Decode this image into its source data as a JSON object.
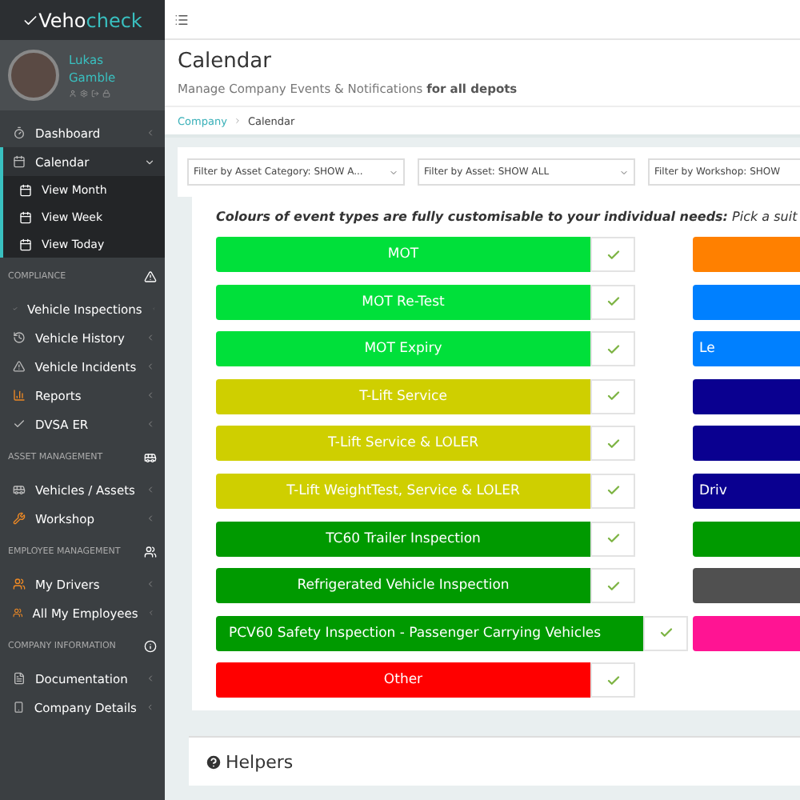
{
  "brand": {
    "first": "Veho",
    "second": "check"
  },
  "user": {
    "name": "Lukas Gamble"
  },
  "sidebar": {
    "sections": [
      {
        "items": [
          {
            "label": "Dashboard",
            "selected": false,
            "expanded": false
          },
          {
            "label": "Calendar",
            "selected": true,
            "expanded": true,
            "children": [
              {
                "label": "View Month"
              },
              {
                "label": "View Week"
              },
              {
                "label": "View Today"
              }
            ]
          }
        ]
      },
      {
        "title": "COMPLIANCE",
        "items": [
          {
            "label": "Vehicle Inspections",
            "selected": false,
            "expanded": false
          },
          {
            "label": "Vehicle History",
            "selected": false,
            "expanded": false
          },
          {
            "label": "Vehicle Incidents",
            "selected": false,
            "expanded": false
          },
          {
            "label": "Reports",
            "selected": false,
            "expanded": false
          },
          {
            "label": "DVSA ER",
            "selected": false,
            "expanded": false
          }
        ]
      },
      {
        "title": "ASSET MANAGEMENT",
        "items": [
          {
            "label": "Vehicles / Assets",
            "selected": false,
            "expanded": false
          },
          {
            "label": "Workshop",
            "selected": false,
            "expanded": false
          }
        ]
      },
      {
        "title": "EMPLOYEE MANAGEMENT",
        "items": [
          {
            "label": "My Drivers",
            "selected": false,
            "expanded": false
          },
          {
            "label": "All My Employees",
            "selected": false,
            "expanded": false
          }
        ]
      },
      {
        "title": "COMPANY INFORMATION",
        "items": [
          {
            "label": "Documentation",
            "selected": false,
            "expanded": false
          },
          {
            "label": "Company Details",
            "selected": false,
            "expanded": false
          }
        ]
      }
    ]
  },
  "page": {
    "title": "Calendar",
    "subtitle": "Manage Company Events & Notifications **for all depots**"
  },
  "breadcrumb": [
    {
      "label": "Company",
      "link": true
    },
    {
      "label": "Calendar",
      "link": false
    }
  ],
  "filters": [
    {
      "label": "Filter by Asset Category: SHOW A..."
    },
    {
      "label": "Filter by Asset: SHOW ALL"
    },
    {
      "label": "Filter by Workshop: SHOW"
    }
  ],
  "intro": "**Colours of event types are fully customisable to your individual needs:** Pick a suit",
  "event_types": [
    [
      {
        "label": "MOT",
        "color": "#00e03a",
        "checked": true,
        "wide": false
      },
      {
        "label": "MOT Re-Test",
        "color": "#00e03a",
        "checked": true,
        "wide": false
      },
      {
        "label": "MOT Expiry",
        "color": "#00e03a",
        "checked": true,
        "wide": false
      },
      {
        "label": "T-Lift Service",
        "color": "#cfcf00",
        "checked": true,
        "wide": false
      },
      {
        "label": "T-Lift Service & LOLER",
        "color": "#cfcf00",
        "checked": true,
        "wide": false
      },
      {
        "label": "T-Lift WeightTest, Service & LOLER",
        "color": "#cfcf00",
        "checked": true,
        "wide": false
      },
      {
        "label": "TC60 Trailer Inspection",
        "color": "#009a00",
        "checked": true,
        "wide": false
      },
      {
        "label": "Refrigerated Vehicle Inspection",
        "color": "#009a00",
        "checked": true,
        "wide": false
      },
      {
        "label": "PCV60 Safety Inspection - Passenger Carrying Vehicles",
        "color": "#009a00",
        "checked": true,
        "wide": true
      },
      {
        "label": "Other",
        "color": "#ff0000",
        "checked": true,
        "wide": false
      }
    ],
    [
      {
        "color": "#ff8000"
      },
      {
        "color": "#0080ff"
      },
      {
        "label": "Le",
        "color": "#0080ff"
      },
      {
        "color": "#0a0090"
      },
      {
        "color": "#0a0090"
      },
      {
        "label": "Driv",
        "color": "#0a0090"
      },
      {
        "color": "#009a00"
      },
      {
        "color": "#505050"
      },
      {
        "color": "#ff1493"
      }
    ]
  ],
  "helpers": {
    "title": "Helpers"
  }
}
